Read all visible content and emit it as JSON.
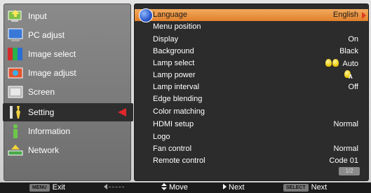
{
  "left_menu": [
    {
      "label": "Input",
      "icon": "input-icon"
    },
    {
      "label": "PC adjust",
      "icon": "pc-adjust-icon"
    },
    {
      "label": "Image select",
      "icon": "image-select-icon"
    },
    {
      "label": "Image adjust",
      "icon": "image-adjust-icon"
    },
    {
      "label": "Screen",
      "icon": "screen-icon"
    },
    {
      "label": "Setting",
      "icon": "setting-icon",
      "selected": true
    },
    {
      "label": "Information",
      "icon": "information-icon"
    },
    {
      "label": "Network",
      "icon": "network-icon"
    }
  ],
  "settings": [
    {
      "label": "Language",
      "value": "English",
      "highlighted": true
    },
    {
      "label": "Menu position",
      "value": ""
    },
    {
      "label": "Display",
      "value": "On"
    },
    {
      "label": "Background",
      "value": "Black"
    },
    {
      "label": "Lamp select",
      "value": "Auto"
    },
    {
      "label": "Lamp power",
      "value": ""
    },
    {
      "label": "Lamp interval",
      "value": "Off"
    },
    {
      "label": "Edge blending",
      "value": ""
    },
    {
      "label": "Color matching",
      "value": ""
    },
    {
      "label": "HDMI setup",
      "value": "Normal"
    },
    {
      "label": "Logo",
      "value": ""
    },
    {
      "label": "Fan control",
      "value": "Normal"
    },
    {
      "label": "Remote control",
      "value": "Code 01"
    }
  ],
  "page_indicator": "1/2",
  "footer": {
    "menu_key": "MENU",
    "exit_label": "Exit",
    "move_label": "Move",
    "next_label": "Next",
    "select_key": "SELECT",
    "select_next_label": "Next"
  },
  "colors": {
    "highlight": "#e8913f",
    "selected_arrow": "#e0272c"
  }
}
